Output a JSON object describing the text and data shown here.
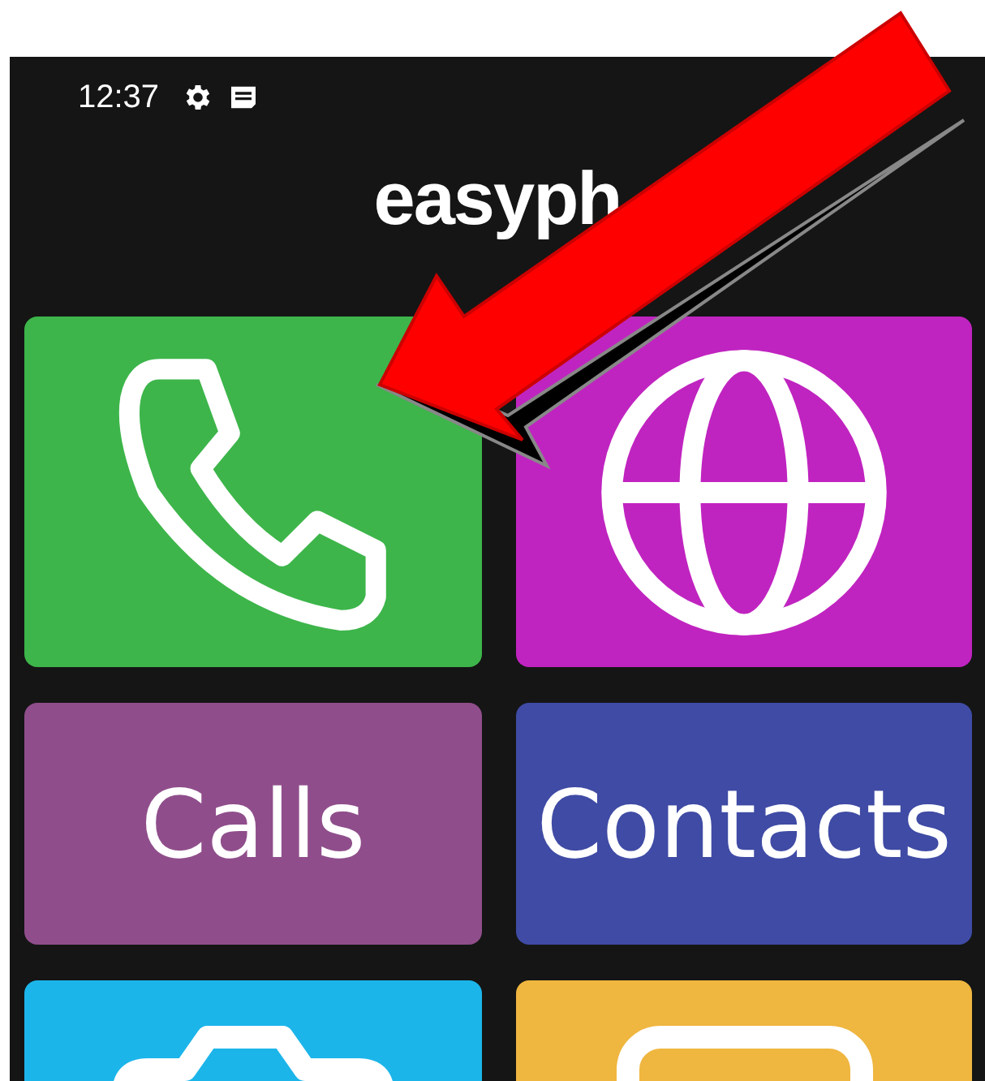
{
  "status_bar": {
    "time": "12:37"
  },
  "logo": {
    "text": "easyph"
  },
  "tiles": [
    {
      "kind": "phone",
      "color": "#3db54a"
    },
    {
      "kind": "globe",
      "color": "#c024c0"
    },
    {
      "kind": "text",
      "label": "Calls",
      "color": "#8f4e8b"
    },
    {
      "kind": "text",
      "label": "Contacts",
      "color": "#3f4ba4"
    },
    {
      "kind": "camera",
      "color": "#1cb5ea"
    },
    {
      "kind": "square",
      "color": "#efb640"
    }
  ]
}
